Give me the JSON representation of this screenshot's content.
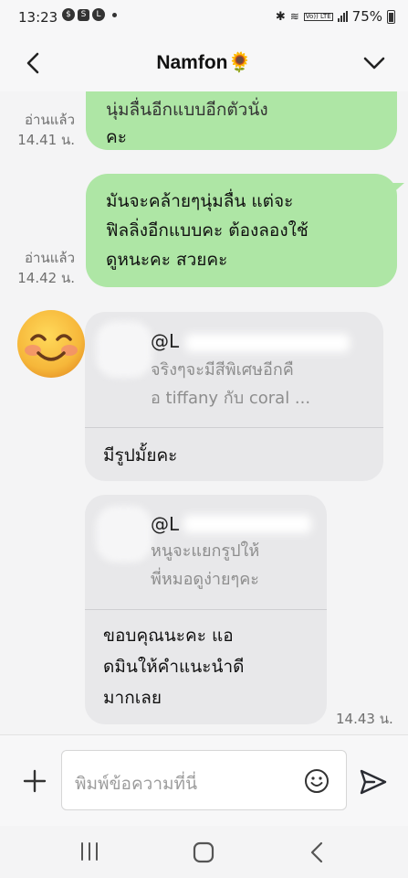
{
  "status_bar": {
    "time": "13:23",
    "volte": "Vo)) LTE",
    "battery": "75%"
  },
  "header": {
    "title": "Namfon🌻"
  },
  "messages_out": [
    {
      "partial_line": "นุ่มลื่นอีกแบบอีกตัวนั่ง",
      "text": "คะ",
      "read_label": "อ่านแล้ว",
      "time": "14.41 น."
    },
    {
      "lines": [
        "มันจะคล้ายๆนุ่มลื่น แต่จะ",
        "ฟิลลิ่งอีกแบบคะ ต้องลองใช้",
        "ดูหนะคะ สวยคะ"
      ],
      "read_label": "อ่านแล้ว",
      "time": "14.42 น."
    }
  ],
  "messages_in": [
    {
      "quote_name": "@L",
      "quote_lines": [
        "จริงๆจะมีสีพิเศษอีกคื",
        "อ tiffany กับ coral ..."
      ],
      "reply_lines": [
        "มีรูปมั้ยคะ"
      ]
    },
    {
      "quote_name": "@L",
      "quote_lines": [
        "หนูจะแยกรูปให้",
        "พี่หมอดูง่ายๆคะ"
      ],
      "reply_lines": [
        "ขอบคุณนะคะ แอ",
        "ดมินให้คำแนะนำดี",
        "มากเลย"
      ],
      "time": "14.43 น."
    }
  ],
  "input": {
    "placeholder": "พิมพ์ข้อความที่นี่"
  },
  "colors": {
    "outgoing_bubble": "#aee6a5",
    "incoming_bubble": "#e8e8ea",
    "accent": "#22242a"
  },
  "icons": {
    "back": "chevron-left",
    "menu": "chevron-down",
    "add": "plus",
    "emoji": "smiley-outline",
    "send": "paper-plane",
    "avatar": "smiling-face-emoji"
  }
}
